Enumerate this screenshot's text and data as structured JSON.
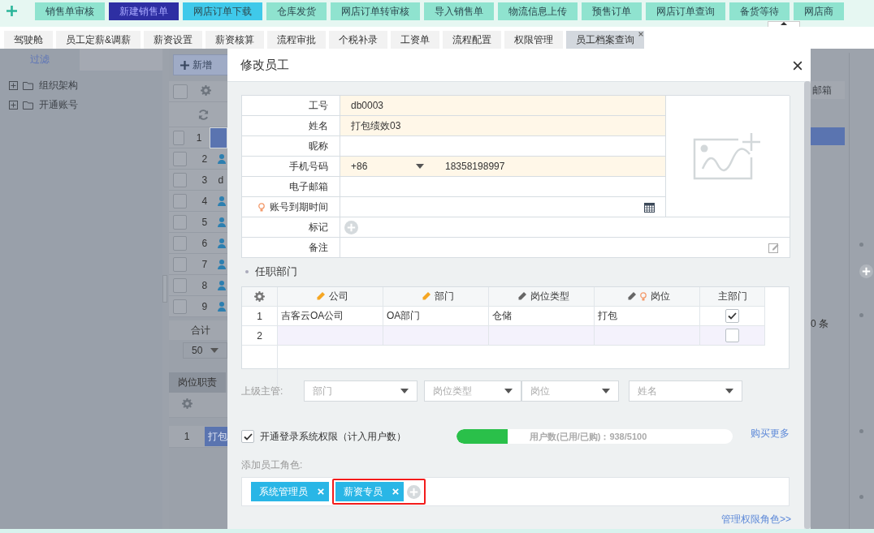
{
  "top_nav": {
    "tabs": [
      {
        "label": "销售单审核",
        "color": "#8fe3cf"
      },
      {
        "label": "新建销售单",
        "color": "#2e2fa3"
      },
      {
        "label": "网店订单下载",
        "color": "#3fc9ea"
      },
      {
        "label": "仓库发货",
        "color": "#8fe3cf"
      },
      {
        "label": "网店订单转审核",
        "color": "#8fe3cf"
      },
      {
        "label": "导入销售单",
        "color": "#8fe3cf"
      },
      {
        "label": "物流信息上传",
        "color": "#8fe3cf"
      },
      {
        "label": "预售订单",
        "color": "#8fe3cf"
      },
      {
        "label": "网店订单查询",
        "color": "#8fe3cf"
      },
      {
        "label": "备货等待",
        "color": "#8fe3cf"
      },
      {
        "label": "网店商",
        "color": "#8fe3cf"
      }
    ]
  },
  "module_tabs": [
    {
      "label": "驾驶舱",
      "selected": false
    },
    {
      "label": "员工定薪&调薪",
      "selected": false
    },
    {
      "label": "薪资设置",
      "selected": false
    },
    {
      "label": "薪资核算",
      "selected": false
    },
    {
      "label": "流程审批",
      "selected": false
    },
    {
      "label": "个税补录",
      "selected": false
    },
    {
      "label": "工资单",
      "selected": false
    },
    {
      "label": "流程配置",
      "selected": false
    },
    {
      "label": "权限管理",
      "selected": false
    },
    {
      "label": "员工档案查询",
      "selected": true
    }
  ],
  "sidebar": {
    "tab": "过滤",
    "items": [
      {
        "label": "组织架构",
        "expanded": false
      },
      {
        "label": "开通账号",
        "expanded": false
      }
    ]
  },
  "employee_list": {
    "add_button": "新增",
    "all_checked": false,
    "rows": [
      {
        "number": "1",
        "kind": "avatar",
        "selected": true,
        "checked": false
      },
      {
        "number": "2",
        "kind": "avatar",
        "selected": false,
        "checked": false
      },
      {
        "number": "3",
        "kind": "text",
        "text": "d",
        "selected": false,
        "checked": false
      },
      {
        "number": "4",
        "kind": "avatar",
        "selected": false,
        "checked": false
      },
      {
        "number": "5",
        "kind": "avatar",
        "selected": false,
        "checked": false
      },
      {
        "number": "6",
        "kind": "avatar",
        "selected": false,
        "checked": false
      },
      {
        "number": "7",
        "kind": "avatar",
        "selected": false,
        "checked": false
      },
      {
        "number": "8",
        "kind": "avatar",
        "selected": false,
        "checked": false
      },
      {
        "number": "9",
        "kind": "avatar",
        "selected": false,
        "checked": false
      }
    ],
    "total_label": "合计",
    "page_size": "50",
    "column_header": "邮箱",
    "count_text": "0 条"
  },
  "position_panel": {
    "tab": "岗位职责",
    "rows": [
      {
        "number": "1",
        "cell": "打包"
      }
    ]
  },
  "dialog": {
    "title": "修改员工",
    "fields": [
      {
        "kind": "text",
        "label": "工号",
        "value": "db0003",
        "required": true,
        "hint_icon": false
      },
      {
        "kind": "text",
        "label": "姓名",
        "value": "打包绩效03",
        "required": true,
        "hint_icon": false
      },
      {
        "kind": "text",
        "label": "昵称",
        "required": false,
        "hint_icon": false
      },
      {
        "kind": "phone",
        "label": "手机号码",
        "country_code": "+86",
        "value": "18358198997",
        "required": true,
        "hint_icon": false
      },
      {
        "kind": "text",
        "label": "电子邮箱",
        "required": false,
        "hint_icon": false
      },
      {
        "kind": "date",
        "label": "账号到期时间",
        "required": false,
        "hint_icon": true
      },
      {
        "kind": "tags",
        "label": "标记",
        "required": false,
        "hint_icon": false
      },
      {
        "kind": "note",
        "label": "备注",
        "required": false,
        "hint_icon": false
      }
    ],
    "department_section": {
      "title": "任职部门",
      "columns": [
        {
          "label": "公司",
          "editable": true,
          "required": true,
          "hint_icon": false
        },
        {
          "label": "部门",
          "editable": true,
          "required": true,
          "hint_icon": false
        },
        {
          "label": "岗位类型",
          "editable": true,
          "required": false,
          "hint_icon": false
        },
        {
          "label": "岗位",
          "editable": true,
          "required": false,
          "hint_icon": true
        },
        {
          "label": "主部门",
          "editable": false,
          "hint_icon": false
        }
      ],
      "rows": [
        {
          "number": "1",
          "cells": [
            "吉客云OA公司",
            "OA部门",
            "仓储",
            "打包"
          ],
          "main": true,
          "selected": false
        },
        {
          "number": "2",
          "cells": [],
          "main": false,
          "selected": true
        }
      ]
    },
    "supervisor": {
      "label": "上级主管:",
      "selects": [
        {
          "placeholder": "部门"
        },
        {
          "placeholder": "岗位类型"
        },
        {
          "placeholder": "岗位"
        },
        {
          "placeholder": "姓名"
        }
      ]
    },
    "login_access": {
      "label": "开通登录系统权限（计入用户数）",
      "checked": true,
      "usage_text": "用户数(已用/已购)：938/5100",
      "level": 0.185,
      "buy_more_link": "购买更多"
    },
    "roles": {
      "label": "添加员工角色:",
      "items": [
        {
          "label": "系统管理员",
          "highlighted": false
        },
        {
          "label": "薪资专员",
          "highlighted": true
        }
      ],
      "manage_link": "管理权限角色>>"
    }
  }
}
